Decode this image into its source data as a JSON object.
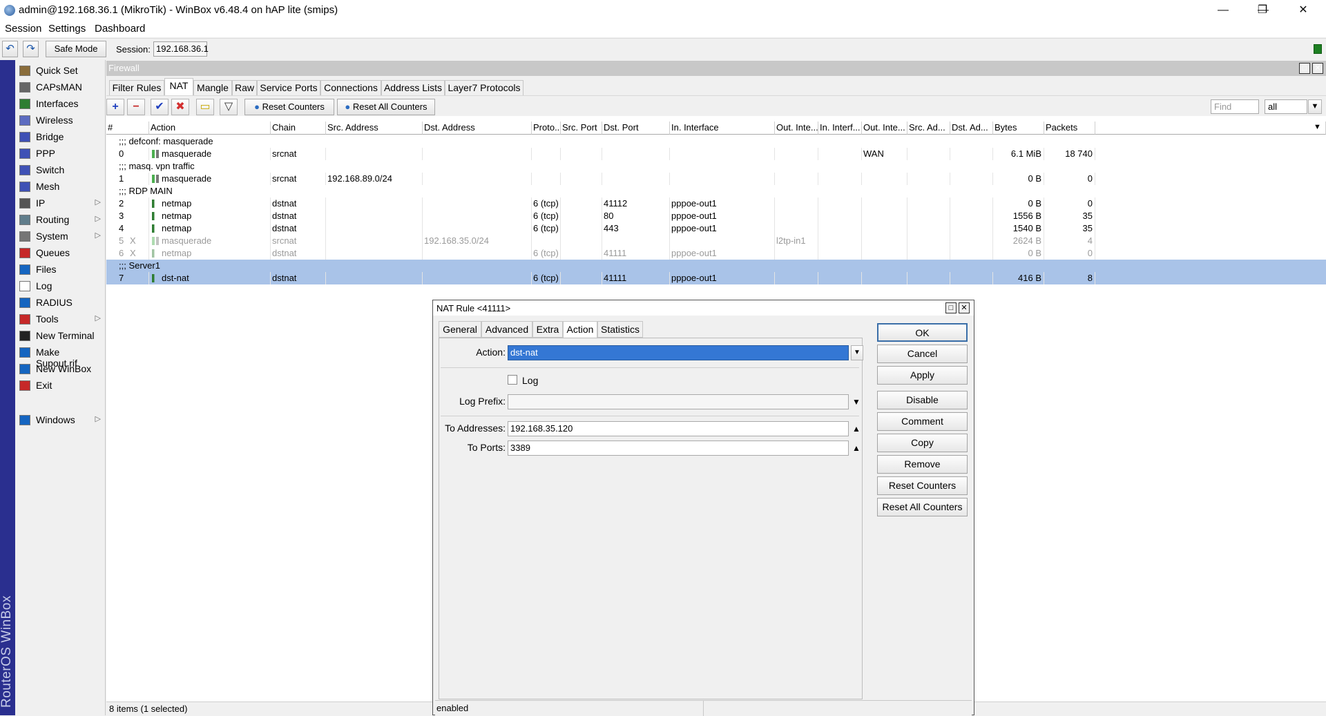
{
  "titlebar": {
    "title": "admin@192.168.36.1 (MikroTik) - WinBox v6.48.4 on hAP lite (smips)",
    "minimize": "—",
    "restore": "❐",
    "close": "✕"
  },
  "menubar": {
    "items": [
      "Session",
      "Settings",
      "Dashboard"
    ]
  },
  "toolbar": {
    "undo": "↶",
    "redo": "↷",
    "safe_mode": "Safe Mode",
    "session_label": "Session:",
    "session_value": "192.168.36.1"
  },
  "brand_strip": "RouterOS WinBox",
  "sidebar": {
    "items": [
      {
        "label": "Quick Set",
        "icon": "quick-set-icon",
        "color": "#8a6d3b",
        "arrow": ""
      },
      {
        "label": "CAPsMAN",
        "icon": "capsman-icon",
        "color": "#666666",
        "arrow": ""
      },
      {
        "label": "Interfaces",
        "icon": "interfaces-icon",
        "color": "#2e7d32",
        "arrow": ""
      },
      {
        "label": "Wireless",
        "icon": "wireless-icon",
        "color": "#5c6bc0",
        "arrow": ""
      },
      {
        "label": "Bridge",
        "icon": "bridge-icon",
        "color": "#3f51b5",
        "arrow": ""
      },
      {
        "label": "PPP",
        "icon": "ppp-icon",
        "color": "#3f51b5",
        "arrow": ""
      },
      {
        "label": "Switch",
        "icon": "switch-icon",
        "color": "#3f51b5",
        "arrow": ""
      },
      {
        "label": "Mesh",
        "icon": "mesh-icon",
        "color": "#3f51b5",
        "arrow": ""
      },
      {
        "label": "IP",
        "icon": "ip-icon",
        "color": "#555555",
        "arrow": "▷"
      },
      {
        "label": "Routing",
        "icon": "routing-icon",
        "color": "#607d8b",
        "arrow": "▷"
      },
      {
        "label": "System",
        "icon": "system-icon",
        "color": "#757575",
        "arrow": "▷"
      },
      {
        "label": "Queues",
        "icon": "queues-icon",
        "color": "#c62828",
        "arrow": ""
      },
      {
        "label": "Files",
        "icon": "files-icon",
        "color": "#1565c0",
        "arrow": ""
      },
      {
        "label": "Log",
        "icon": "log-icon",
        "color": "#ffffff",
        "arrow": ""
      },
      {
        "label": "RADIUS",
        "icon": "radius-icon",
        "color": "#1565c0",
        "arrow": ""
      },
      {
        "label": "Tools",
        "icon": "tools-icon",
        "color": "#c62828",
        "arrow": "▷"
      },
      {
        "label": "New Terminal",
        "icon": "terminal-icon",
        "color": "#222222",
        "arrow": ""
      },
      {
        "label": "Make Supout.rif",
        "icon": "supout-icon",
        "color": "#1565c0",
        "arrow": ""
      },
      {
        "label": "New WinBox",
        "icon": "winbox-icon",
        "color": "#1565c0",
        "arrow": ""
      },
      {
        "label": "Exit",
        "icon": "exit-icon",
        "color": "#c62828",
        "arrow": ""
      },
      {
        "label": "Windows",
        "icon": "windows-icon",
        "color": "#1565c0",
        "arrow": "▷"
      }
    ]
  },
  "firewall": {
    "title": "Firewall",
    "tabs": [
      "Filter Rules",
      "NAT",
      "Mangle",
      "Raw",
      "Service Ports",
      "Connections",
      "Address Lists",
      "Layer7 Protocols"
    ],
    "active_tab": "NAT",
    "tool": {
      "add": "+",
      "remove": "−",
      "enable": "✔",
      "disable": "✖",
      "comment": "▭",
      "filter": "▽",
      "reset_counters": "Reset Counters",
      "reset_all_counters": "Reset All Counters",
      "find_placeholder": "Find",
      "filter_select": "all"
    },
    "columns": [
      "#",
      "Action",
      "Chain",
      "Src. Address",
      "Dst. Address",
      "Proto...",
      "Src. Port",
      "Dst. Port",
      "In. Interface",
      "Out. Inte...",
      "In. Interf...",
      "Out. Inte...",
      "Src. Ad...",
      "Dst. Ad...",
      "Bytes",
      "Packets"
    ],
    "rows": [
      {
        "type": "comment",
        "text": ";;; defconf: masquerade"
      },
      {
        "type": "rule",
        "num": "0",
        "flag": "",
        "action": "masquerade",
        "chain": "srcnat",
        "src": "",
        "dst": "",
        "proto": "",
        "sport": "",
        "dport": "",
        "inif": "",
        "outif": "",
        "inif2": "",
        "outif2": "WAN",
        "srcad": "",
        "dstad": "",
        "bytes": "6.1 MiB",
        "packets": "18 740"
      },
      {
        "type": "comment",
        "text": ";;; masq. vpn traffic"
      },
      {
        "type": "rule",
        "num": "1",
        "flag": "",
        "action": "masquerade",
        "chain": "srcnat",
        "src": "192.168.89.0/24",
        "dst": "",
        "proto": "",
        "sport": "",
        "dport": "",
        "inif": "",
        "outif": "",
        "inif2": "",
        "outif2": "",
        "srcad": "",
        "dstad": "",
        "bytes": "0 B",
        "packets": "0"
      },
      {
        "type": "comment",
        "text": ";;; RDP MAIN"
      },
      {
        "type": "rule",
        "num": "2",
        "flag": "",
        "action": "netmap",
        "chain": "dstnat",
        "src": "",
        "dst": "",
        "proto": "6 (tcp)",
        "sport": "",
        "dport": "41112",
        "inif": "pppoe-out1",
        "outif": "",
        "inif2": "",
        "outif2": "",
        "srcad": "",
        "dstad": "",
        "bytes": "0 B",
        "packets": "0"
      },
      {
        "type": "rule",
        "num": "3",
        "flag": "",
        "action": "netmap",
        "chain": "dstnat",
        "src": "",
        "dst": "",
        "proto": "6 (tcp)",
        "sport": "",
        "dport": "80",
        "inif": "pppoe-out1",
        "outif": "",
        "inif2": "",
        "outif2": "",
        "srcad": "",
        "dstad": "",
        "bytes": "1556 B",
        "packets": "35"
      },
      {
        "type": "rule",
        "num": "4",
        "flag": "",
        "action": "netmap",
        "chain": "dstnat",
        "src": "",
        "dst": "",
        "proto": "6 (tcp)",
        "sport": "",
        "dport": "443",
        "inif": "pppoe-out1",
        "outif": "",
        "inif2": "",
        "outif2": "",
        "srcad": "",
        "dstad": "",
        "bytes": "1540 B",
        "packets": "35"
      },
      {
        "type": "disabled",
        "num": "5",
        "flag": "X",
        "action": "masquerade",
        "chain": "srcnat",
        "src": "",
        "dst": "192.168.35.0/24",
        "proto": "",
        "sport": "",
        "dport": "",
        "inif": "",
        "outif": "l2tp-in1",
        "inif2": "",
        "outif2": "",
        "srcad": "",
        "dstad": "",
        "bytes": "2624 B",
        "packets": "4"
      },
      {
        "type": "disabled",
        "num": "6",
        "flag": "X",
        "action": "netmap",
        "chain": "dstnat",
        "src": "",
        "dst": "",
        "proto": "6 (tcp)",
        "sport": "",
        "dport": "41111",
        "inif": "pppoe-out1",
        "outif": "",
        "inif2": "",
        "outif2": "",
        "srcad": "",
        "dstad": "",
        "bytes": "0 B",
        "packets": "0"
      },
      {
        "type": "commentsel",
        "text": ";;; Server1"
      },
      {
        "type": "selected",
        "num": "7",
        "flag": "",
        "action": "dst-nat",
        "chain": "dstnat",
        "src": "",
        "dst": "",
        "proto": "6 (tcp)",
        "sport": "",
        "dport": "41111",
        "inif": "pppoe-out1",
        "outif": "",
        "inif2": "",
        "outif2": "",
        "srcad": "",
        "dstad": "",
        "bytes": "416 B",
        "packets": "8"
      }
    ],
    "status": "8 items (1 selected)"
  },
  "dialog": {
    "title": "NAT Rule <41111>",
    "tabs": [
      "General",
      "Advanced",
      "Extra",
      "Action",
      "Statistics"
    ],
    "active_tab": "Action",
    "action_label": "Action:",
    "action_value": "dst-nat",
    "log_label": "Log",
    "log_prefix_label": "Log Prefix:",
    "log_prefix_value": "",
    "to_addresses_label": "To Addresses:",
    "to_addresses_value": "192.168.35.120",
    "to_ports_label": "To Ports:",
    "to_ports_value": "3389",
    "buttons": [
      "OK",
      "Cancel",
      "Apply",
      "Disable",
      "Comment",
      "Copy",
      "Remove",
      "Reset Counters",
      "Reset All Counters"
    ],
    "status": "enabled"
  }
}
